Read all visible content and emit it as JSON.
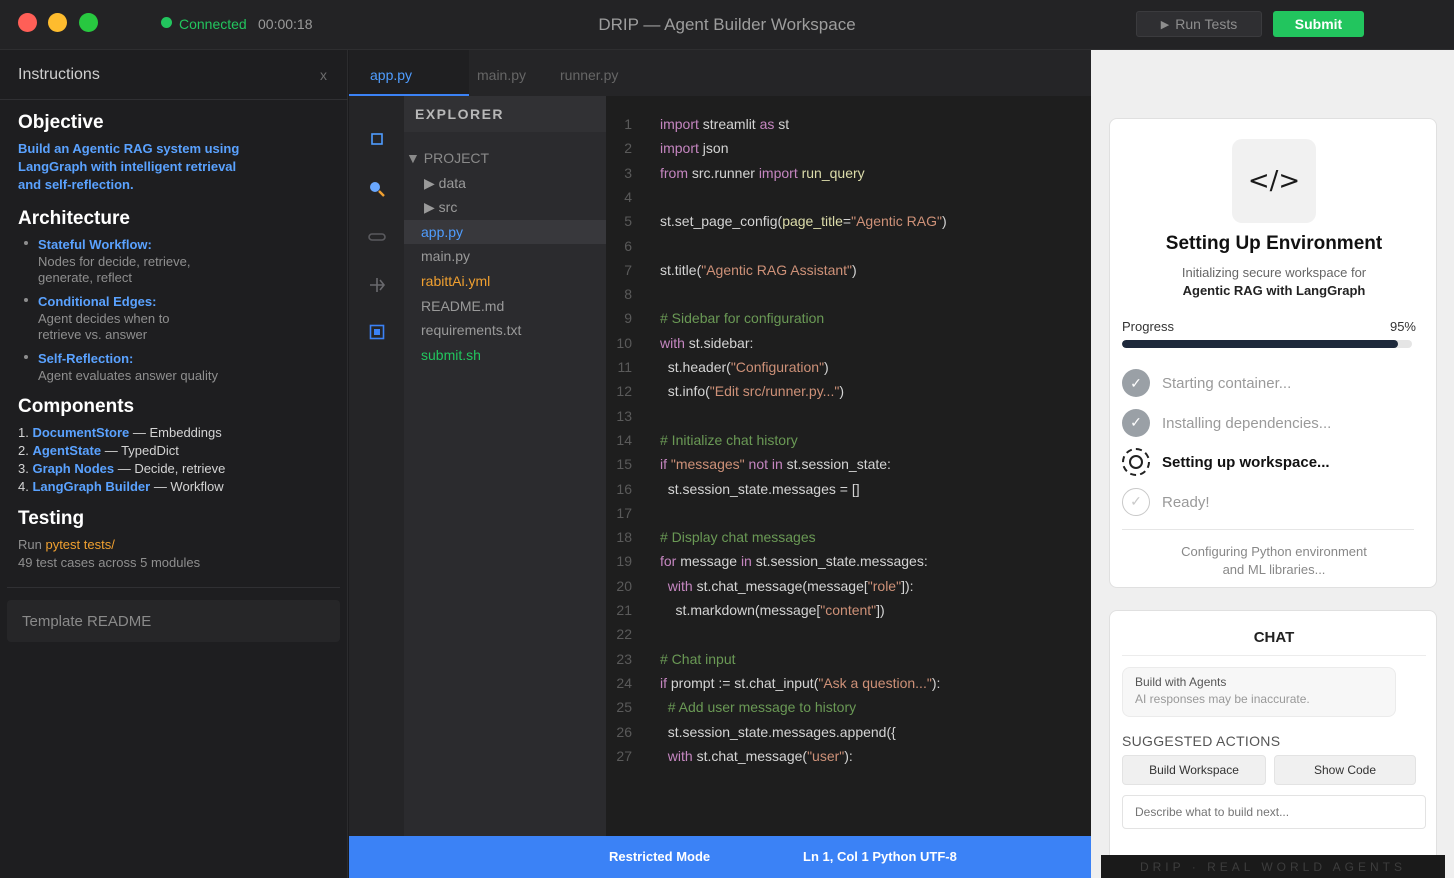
{
  "titlebar": {
    "status": "Connected",
    "timer": "00:00:18",
    "title": "DRIP — Agent Builder Workspace",
    "run_tests": "Run Tests",
    "submit": "Submit"
  },
  "instructions": {
    "header": "Instructions",
    "close": "x",
    "objective_heading": "Objective",
    "objective_text": "Build an Agentic RAG system using LangGraph with intelligent retrieval and self-reflection.",
    "architecture_heading": "Architecture",
    "architecture_items": [
      {
        "name": "Stateful Workflow:",
        "desc": "Nodes for decide, retrieve, generate, reflect"
      },
      {
        "name": "Conditional Edges:",
        "desc": "Agent decides when to retrieve vs. answer"
      },
      {
        "name": "Self-Reflection:",
        "desc": "Agent evaluates answer quality"
      }
    ],
    "components_heading": "Components",
    "components": [
      {
        "num": "1.",
        "name": "DocumentStore",
        "desc": " — Embeddings"
      },
      {
        "num": "2.",
        "name": "AgentState",
        "desc": " — TypedDict"
      },
      {
        "num": "3.",
        "name": "Graph Nodes",
        "desc": " — Decide, retrieve"
      },
      {
        "num": "4.",
        "name": "LangGraph Builder",
        "desc": " — Workflow"
      }
    ],
    "testing_heading": "Testing",
    "testing_run": "Run ",
    "testing_cmd": "pytest tests/",
    "testing_count": "49 test cases across 5 modules",
    "template_button": "Template README"
  },
  "editor": {
    "tabs": [
      "app.py",
      "main.py",
      "runner.py"
    ],
    "explorer_title": "EXPLORER",
    "tree": [
      {
        "label": "▼ PROJECT",
        "color": "#8a8a8a",
        "indent": 2
      },
      {
        "label": "▶ data",
        "color": "#9a9a9a",
        "indent": 20
      },
      {
        "label": "▶ src",
        "color": "#9a9a9a",
        "indent": 20
      },
      {
        "label": "app.py",
        "color": "#4f9dff",
        "indent": 17,
        "selected": true
      },
      {
        "label": "main.py",
        "color": "#9a9a9a",
        "indent": 17
      },
      {
        "label": "rabittAi.yml",
        "color": "#f0a030",
        "indent": 17
      },
      {
        "label": "README.md",
        "color": "#9a9a9a",
        "indent": 17
      },
      {
        "label": "requirements.txt",
        "color": "#9a9a9a",
        "indent": 17
      },
      {
        "label": "submit.sh",
        "color": "#22c55e",
        "indent": 17
      }
    ],
    "status_left": "Restricted Mode",
    "status_right": "Ln 1, Col 1 Python UTF-8"
  },
  "code_lines": [
    [
      [
        "kw",
        "import"
      ],
      [
        "pl",
        " streamlit "
      ],
      [
        "kw",
        "as"
      ],
      [
        "pl",
        " st"
      ]
    ],
    [
      [
        "kw",
        "import"
      ],
      [
        "pl",
        " json"
      ]
    ],
    [
      [
        "kw",
        "from"
      ],
      [
        "pl",
        " src.runner "
      ],
      [
        "kw",
        "import"
      ],
      [
        "fn",
        " run_query"
      ]
    ],
    [],
    [
      [
        "pl",
        "st.set_page_config("
      ],
      [
        "fn",
        "page_title"
      ],
      [
        "pl",
        "="
      ],
      [
        "st",
        "\"Agentic RAG\""
      ],
      [
        "pl",
        ")"
      ]
    ],
    [],
    [
      [
        "pl",
        "st.title("
      ],
      [
        "st",
        "\"Agentic RAG Assistant\""
      ],
      [
        "pl",
        ")"
      ]
    ],
    [],
    [
      [
        "cm",
        "# Sidebar for configuration"
      ]
    ],
    [
      [
        "kw",
        "with"
      ],
      [
        "pl",
        " st.sidebar:"
      ]
    ],
    [
      [
        "pl",
        "  st.header("
      ],
      [
        "st",
        "\"Configuration\""
      ],
      [
        "pl",
        ")"
      ]
    ],
    [
      [
        "pl",
        "  st.info("
      ],
      [
        "st",
        "\"Edit src/runner.py...\""
      ],
      [
        "pl",
        ")"
      ]
    ],
    [],
    [
      [
        "cm",
        "# Initialize chat history"
      ]
    ],
    [
      [
        "kw",
        "if"
      ],
      [
        "st",
        " \"messages\""
      ],
      [
        "kw",
        " not in"
      ],
      [
        "pl",
        " st.session_state:"
      ]
    ],
    [
      [
        "pl",
        "  st.session_state.messages = []"
      ]
    ],
    [],
    [
      [
        "cm",
        "# Display chat messages"
      ]
    ],
    [
      [
        "kw",
        "for"
      ],
      [
        "pl",
        " message "
      ],
      [
        "kw",
        "in"
      ],
      [
        "pl",
        " st.session_state.messages:"
      ]
    ],
    [
      [
        "kw",
        "  with"
      ],
      [
        "pl",
        " st.chat_message(message["
      ],
      [
        "st",
        "\"role\""
      ],
      [
        "pl",
        "]):"
      ]
    ],
    [
      [
        "pl",
        "    st.markdown(message["
      ],
      [
        "st",
        "\"content\""
      ],
      [
        "pl",
        "])"
      ]
    ],
    [],
    [
      [
        "cm",
        "# Chat input"
      ]
    ],
    [
      [
        "kw",
        "if"
      ],
      [
        "pl",
        " prompt := st.chat_input("
      ],
      [
        "st",
        "\"Ask a question...\""
      ],
      [
        "pl",
        "):"
      ]
    ],
    [
      [
        "cm",
        "  # Add user message to history"
      ]
    ],
    [
      [
        "pl",
        "  st.session_state.messages.append({"
      ]
    ],
    [
      [
        "kw",
        "  with"
      ],
      [
        "pl",
        " st.chat_message("
      ],
      [
        "st",
        "\"user\""
      ],
      [
        "pl",
        "):"
      ]
    ]
  ],
  "environment": {
    "icon": "</>",
    "title": "Setting Up Environment",
    "subtitle_line1": "Initializing secure workspace for",
    "subtitle_line2": "Agentic RAG with LangGraph",
    "progress_label": "Progress",
    "progress_text": "95%",
    "progress_value": 0.95,
    "steps": [
      {
        "label": "Starting container...",
        "state": "done"
      },
      {
        "label": "Installing dependencies...",
        "state": "done"
      },
      {
        "label": "Setting up workspace...",
        "state": "active"
      },
      {
        "label": "Ready!",
        "state": "pending"
      }
    ],
    "footer": "Configuring Python environment and ML libraries..."
  },
  "chat": {
    "title": "CHAT",
    "bubble_title": "Build with Agents",
    "bubble_note": "AI responses may be inaccurate.",
    "suggested_label": "SUGGESTED ACTIONS",
    "action1": "Build Workspace",
    "action2": "Show Code",
    "input_placeholder": "Describe what to build next..."
  },
  "footer_band": "DRIP · REAL WORLD AGENTS",
  "colors": {
    "accent_blue": "#3b82f6",
    "success_green": "#22c55e",
    "warning_orange": "#f0a030"
  }
}
